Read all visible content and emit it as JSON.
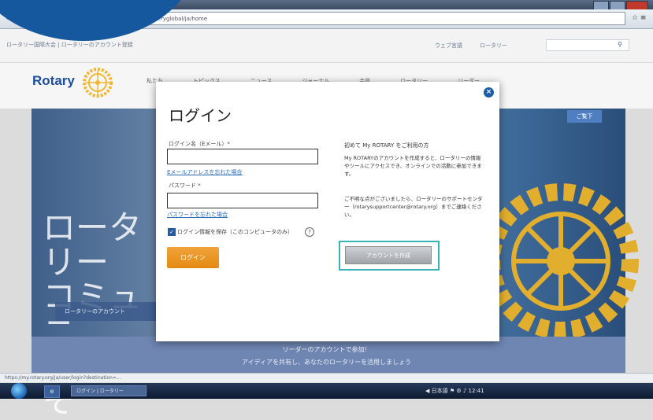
{
  "browser": {
    "url": "…ryglobal/ja/home",
    "right_icons": "☆ ≡"
  },
  "site": {
    "top_links": "ロータリー国際大会 | ロータリーのアカウント登録",
    "top_right_links": [
      "ウェブ言語",
      "ロータリー",
      "検索"
    ],
    "logo_text": "Rotary",
    "nav_items": [
      "私たち",
      "トピックス",
      "ニュース",
      "ジャーナル",
      "会員",
      "ロータリー",
      "リーダー"
    ],
    "hero_tag": "ご覧下",
    "hero_lines": [
      "ロータリー",
      "コミュニ",
      "ようこそ"
    ],
    "hero_button": "ロータリーのアカウント",
    "footer_line1": "リーダーのアカウントで参加！",
    "footer_line2": "アイディアを共有し、あなたのロータリーを活用しましょう"
  },
  "modal": {
    "title": "ログイン",
    "email_label": "ログイン名（Eメール）*",
    "forgot_email": "Eメールアドレスを忘れた場合",
    "password_label": "パスワード *",
    "forgot_password": "パスワードを忘れた場合",
    "remember_label": "ログイン情報を保存（このコンピュータのみ）",
    "help_icon": "?",
    "login_button": "ログイン",
    "right_heading": "初めて My ROTARY をご利用の方",
    "right_para1": "My ROTARYのアカウントを作成すると、ロータリーの情報やツールにアクセスでき、オンラインでの活動に参加できます。",
    "right_para2": "ご不明な点がございましたら、ロータリーのサポートセンター（rotarysupportcenter@rotary.org）までご連絡ください。",
    "create_account_button": "アカウントを作成",
    "close_icon": "×"
  },
  "status": {
    "text": "https://my.rotary.org/ja/user/login?destination=..."
  },
  "taskbar": {
    "window_label": "ログイン | ロータリー",
    "tray": "◀ 日本語 ⚑ ⚙ ♪ 12:41"
  },
  "colors": {
    "brand_blue": "#1e4e9a",
    "login_orange": "#e48a12",
    "highlight_teal": "#3ab3b8",
    "circle_blue": "#15589d"
  }
}
